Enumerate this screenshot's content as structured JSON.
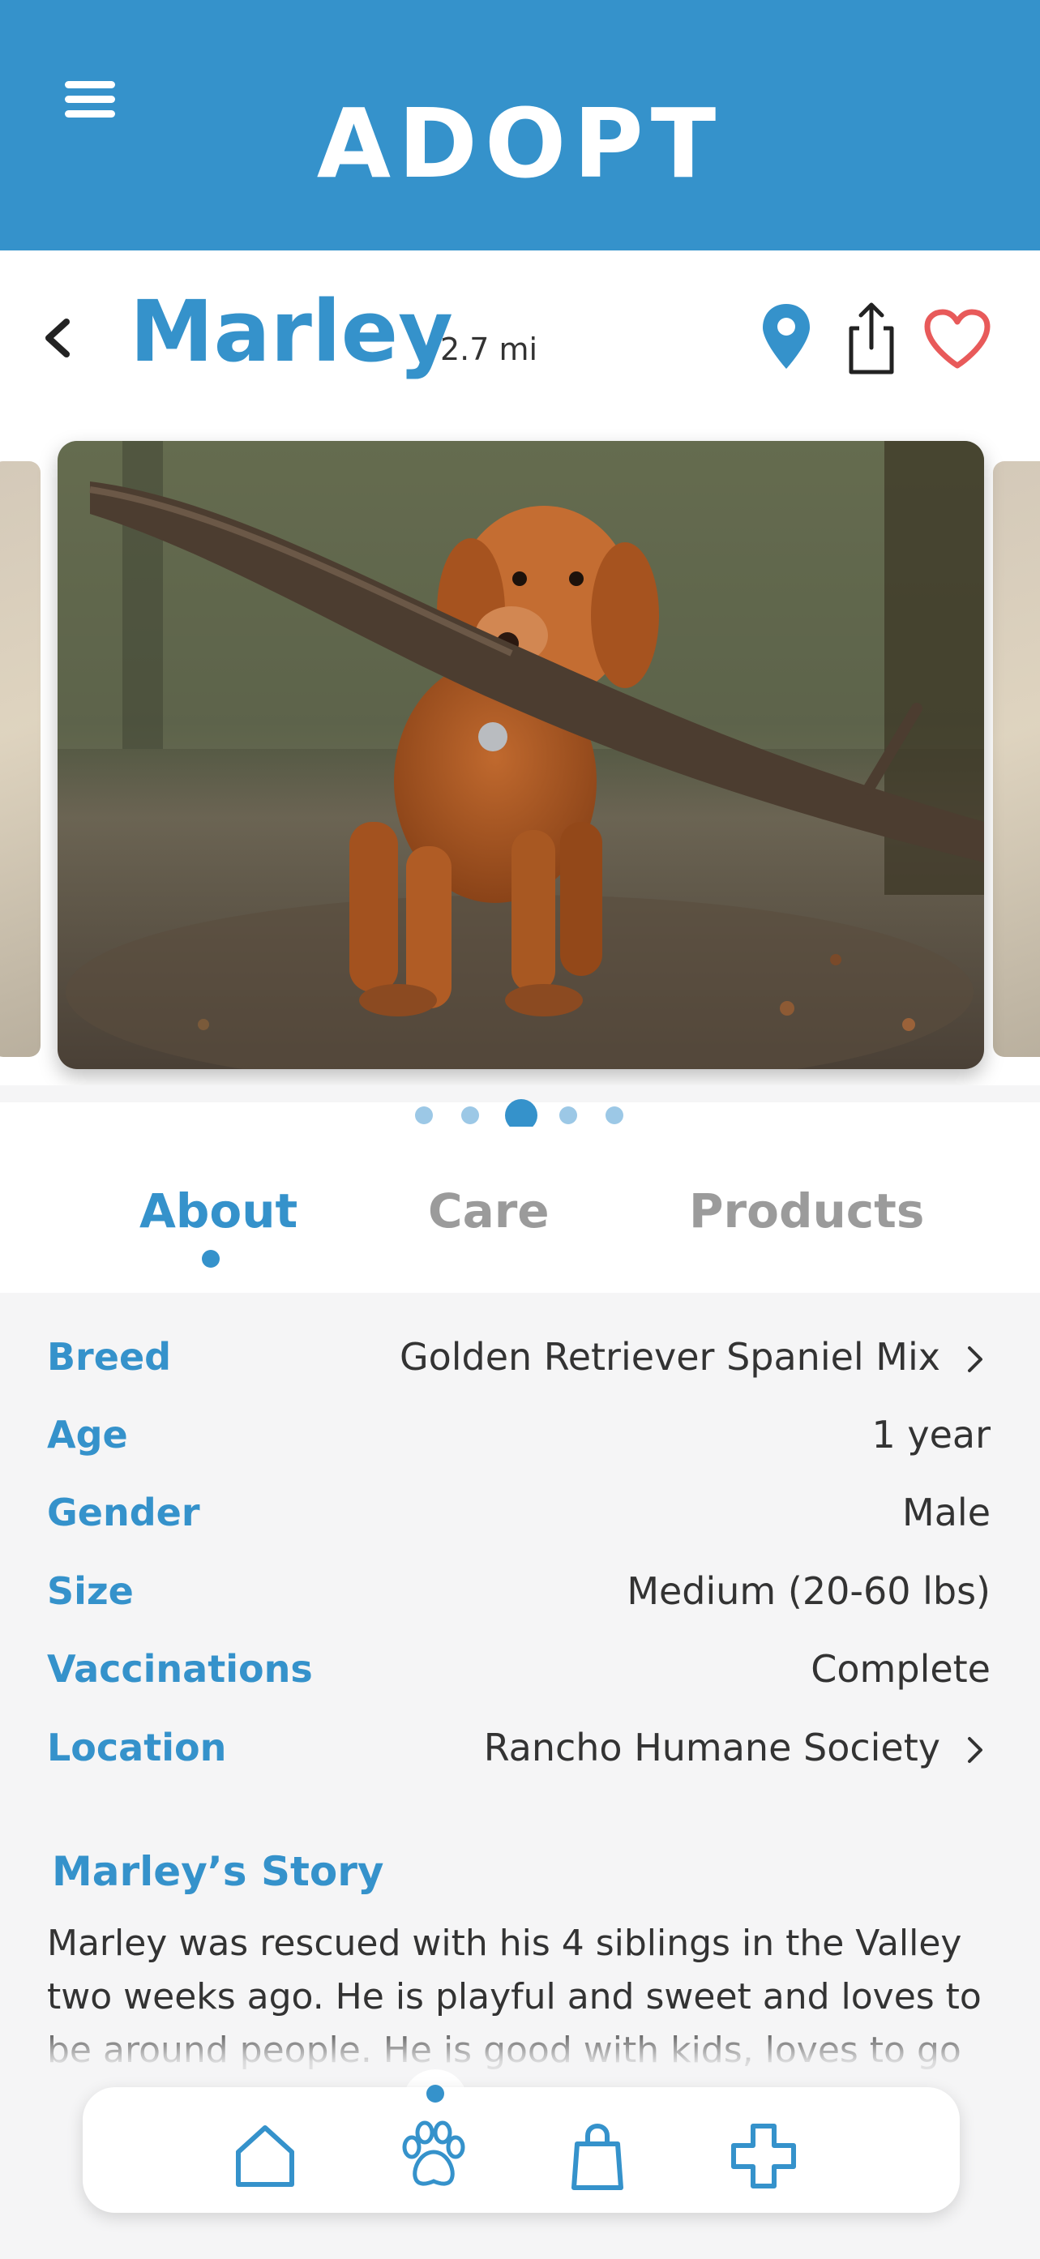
{
  "header": {
    "title": "ADOPT",
    "menu_icon": "hamburger-menu-icon",
    "background_color": "#3592cb"
  },
  "pet": {
    "name": "Marley",
    "distance": "2.7 mi",
    "actions": [
      "location-pin-icon",
      "share-icon",
      "heart-icon"
    ]
  },
  "gallery": {
    "photo_description_icon": "dog-photo",
    "dot_count": 5,
    "active_index": 2
  },
  "tabs": [
    {
      "label": "About",
      "active": true
    },
    {
      "label": "Care",
      "active": false
    },
    {
      "label": "Products",
      "active": false
    }
  ],
  "details": [
    {
      "label": "Breed",
      "value": "Golden Retriever Spaniel Mix",
      "chevron": true
    },
    {
      "label": "Age",
      "value": "1 year",
      "chevron": false
    },
    {
      "label": "Gender",
      "value": "Male",
      "chevron": false
    },
    {
      "label": "Size",
      "value": "Medium (20-60 lbs)",
      "chevron": false
    },
    {
      "label": "Vaccinations",
      "value": "Complete",
      "chevron": false
    },
    {
      "label": "Location",
      "value": "Rancho Humane Society",
      "chevron": true
    }
  ],
  "story": {
    "title": "Marley’s Story",
    "text": "Marley was rescued with his 4 siblings in the Valley two weeks ago. He is playful and sweet and loves to be around people. He is good with kids, loves to go"
  },
  "bottom_nav": {
    "items": [
      "home-icon",
      "paw-icon",
      "shopping-bag-icon",
      "medical-cross-icon"
    ],
    "active_index": 1
  },
  "colors": {
    "accent": "#3592cb",
    "heart": "#e85a5a",
    "text": "#333333",
    "muted": "#9b9b9b",
    "background": "#f5f5f6"
  }
}
